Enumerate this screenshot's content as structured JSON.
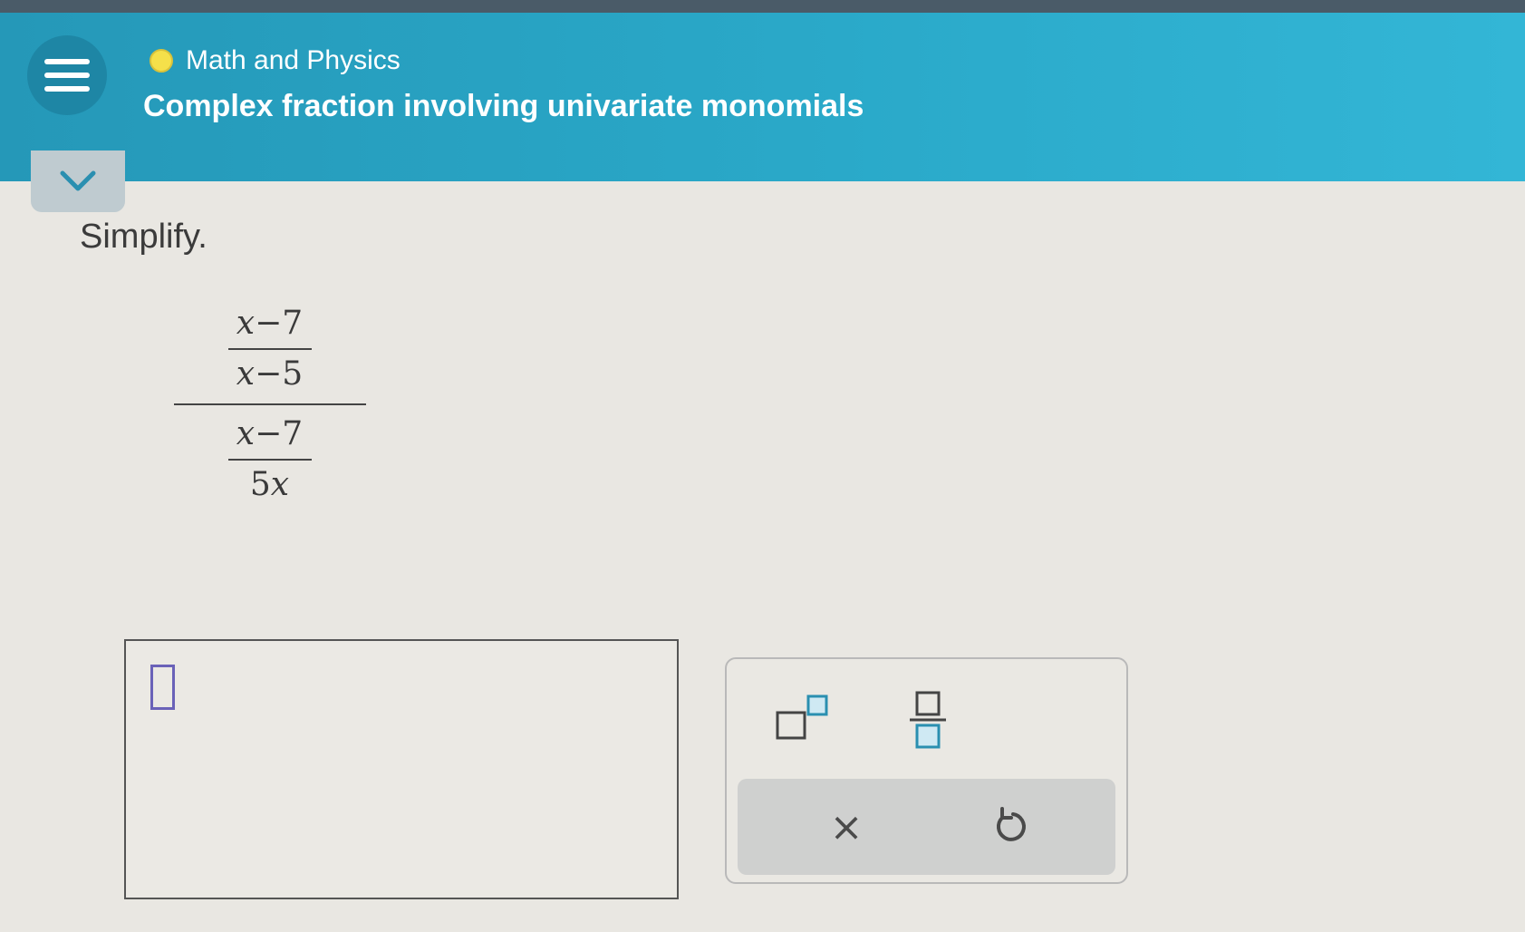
{
  "header": {
    "topic": "Math and Physics",
    "title": "Complex fraction involving univariate monomials"
  },
  "problem": {
    "instruction": "Simplify.",
    "expression": {
      "top": {
        "numerator": {
          "var": "x",
          "rest": "−7"
        },
        "denominator": {
          "var": "x",
          "rest": "−5"
        }
      },
      "bottom": {
        "numerator": {
          "var": "x",
          "rest": "−7"
        },
        "denominator": {
          "coef": "5",
          "var": "x"
        }
      }
    }
  },
  "answer": {
    "value": ""
  },
  "keypad": {
    "clear_label": "×",
    "icons": [
      "superscript-icon",
      "fraction-icon",
      "undo-icon"
    ]
  },
  "colors": {
    "header": "#2aa9c9",
    "menu_button": "#1e86a5",
    "topic_dot": "#f5e04a",
    "cursor": "#6a62b8",
    "keypad_icon": "#2a8fb0"
  }
}
